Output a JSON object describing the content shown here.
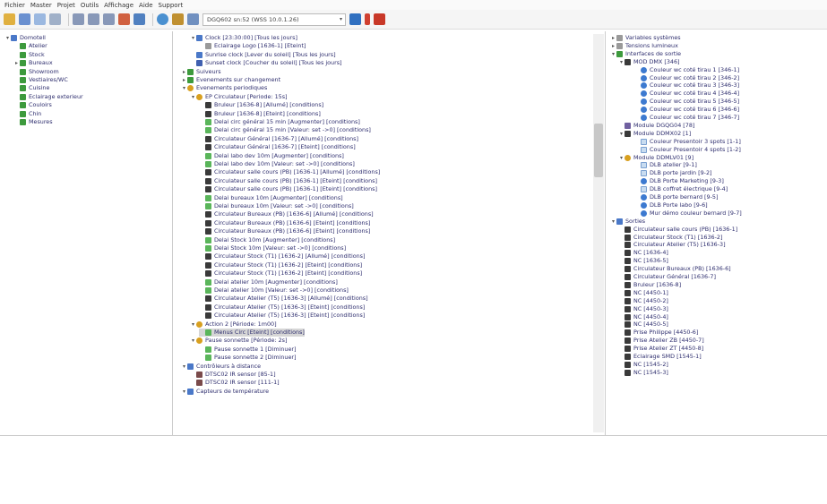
{
  "menu": [
    "Fichier",
    "Master",
    "Projet",
    "Outils",
    "Affichage",
    "Aide",
    "Support"
  ],
  "toolbar": {
    "server": "DGQ602 sn:52 (WSS 10.0.1.26)",
    "icon_names": [
      "folder-icon",
      "new-icon",
      "save-icon",
      "undo-icon",
      "redo-icon",
      "prev-icon",
      "next-icon",
      "scene-icon",
      "tools-icon",
      "monitor-icon",
      "globe-icon",
      "user-icon",
      "device-icon",
      "refresh-icon",
      "flag-icon",
      "stop-icon"
    ]
  },
  "left": [
    {
      "t": "▾",
      "i": "b",
      "l": "Domotell",
      "d": 0
    },
    {
      "t": "",
      "i": "g",
      "l": "Atelier",
      "d": 1
    },
    {
      "t": "",
      "i": "g",
      "l": "Stock",
      "d": 1
    },
    {
      "t": "▸",
      "i": "g",
      "l": "Bureaux",
      "d": 1
    },
    {
      "t": "",
      "i": "g",
      "l": "Showroom",
      "d": 1
    },
    {
      "t": "",
      "i": "g",
      "l": "Vestiaires/WC",
      "d": 1
    },
    {
      "t": "",
      "i": "g",
      "l": "Cuisine",
      "d": 1
    },
    {
      "t": "",
      "i": "g",
      "l": "Eclairage exterieur",
      "d": 1
    },
    {
      "t": "",
      "i": "g",
      "l": "Couloirs",
      "d": 1
    },
    {
      "t": "",
      "i": "g",
      "l": "Chin",
      "d": 1
    },
    {
      "t": "",
      "i": "g",
      "l": "Mesures",
      "d": 1
    }
  ],
  "mid": [
    {
      "t": "▾",
      "i": "b",
      "l": "Clock [23:30:00] [Tous les jours]",
      "d": 1
    },
    {
      "t": "",
      "i": "gr",
      "l": "Eclairage Logo [1636-1] [Eteint]",
      "d": 2
    },
    {
      "t": "",
      "i": "b",
      "l": "Sunrise clock [Lever du soleil] [Tous les jours]",
      "d": 1
    },
    {
      "t": "",
      "i": "db",
      "l": "Sunset clock [Coucher du soleil] [Tous les jours]",
      "d": 1
    },
    {
      "t": "▸",
      "i": "g",
      "l": "Suiveurs",
      "d": 0
    },
    {
      "t": "▸",
      "i": "g",
      "l": "Evenements sur changement",
      "d": 0
    },
    {
      "t": "▾",
      "i": "o",
      "l": "Evenements periodiques",
      "d": 0
    },
    {
      "t": "▾",
      "i": "o",
      "l": "EP Circulateur [Periode: 15s]",
      "d": 1
    },
    {
      "t": "",
      "i": "dk",
      "l": "Bruleur [1636-8] [Allumé] [conditions]",
      "d": 2
    },
    {
      "t": "",
      "i": "dk",
      "l": "Bruleur [1636-8] [Eteint] [conditions]",
      "d": 2
    },
    {
      "t": "",
      "i": "lg",
      "l": "Delai circ général 15 min [Augmenter] [conditions]",
      "d": 2
    },
    {
      "t": "",
      "i": "lg",
      "l": "Delai circ général 15 min [Valeur: set ->0] [conditions]",
      "d": 2
    },
    {
      "t": "",
      "i": "dk",
      "l": "Circulateur Général [1636-7] [Allumé] [conditions]",
      "d": 2
    },
    {
      "t": "",
      "i": "dk",
      "l": "Circulateur Général [1636-7] [Eteint] [conditions]",
      "d": 2
    },
    {
      "t": "",
      "i": "lg",
      "l": "Delai labo dev 10m [Augmenter] [conditions]",
      "d": 2
    },
    {
      "t": "",
      "i": "lg",
      "l": "Delai labo dev 10m [Valeur: set ->0] [conditions]",
      "d": 2
    },
    {
      "t": "",
      "i": "dk",
      "l": "Circulateur salle cours (PB) [1636-1] [Allumé] [conditions]",
      "d": 2
    },
    {
      "t": "",
      "i": "dk",
      "l": "Circulateur salle cours (PB) [1636-1] [Eteint] [conditions]",
      "d": 2
    },
    {
      "t": "",
      "i": "dk",
      "l": "Circulateur salle cours (PB) [1636-1] [Eteint] [conditions]",
      "d": 2
    },
    {
      "t": "",
      "i": "lg",
      "l": "Delai bureaux 10m [Augmenter] [conditions]",
      "d": 2
    },
    {
      "t": "",
      "i": "lg",
      "l": "Delai bureaux 10m [Valeur: set ->0] [conditions]",
      "d": 2
    },
    {
      "t": "",
      "i": "dk",
      "l": "Circulateur Bureaux (PB) [1636-6] [Allumé] [conditions]",
      "d": 2
    },
    {
      "t": "",
      "i": "dk",
      "l": "Circulateur Bureaux (PB) [1636-6] [Eteint] [conditions]",
      "d": 2
    },
    {
      "t": "",
      "i": "dk",
      "l": "Circulateur Bureaux (PB) [1636-6] [Eteint] [conditions]",
      "d": 2
    },
    {
      "t": "",
      "i": "lg",
      "l": "Delai Stock 10m [Augmenter] [conditions]",
      "d": 2
    },
    {
      "t": "",
      "i": "lg",
      "l": "Delai Stock 10m [Valeur: set ->0] [conditions]",
      "d": 2
    },
    {
      "t": "",
      "i": "dk",
      "l": "Circulateur Stock (T1) [1636-2] [Allumé] [conditions]",
      "d": 2
    },
    {
      "t": "",
      "i": "dk",
      "l": "Circulateur Stock (T1) [1636-2] [Eteint] [conditions]",
      "d": 2
    },
    {
      "t": "",
      "i": "dk",
      "l": "Circulateur Stock (T1) [1636-2] [Eteint] [conditions]",
      "d": 2
    },
    {
      "t": "",
      "i": "lg",
      "l": "Delai atelier 10m [Augmenter] [conditions]",
      "d": 2
    },
    {
      "t": "",
      "i": "lg",
      "l": "Delai atelier 10m [Valeur: set ->0] [conditions]",
      "d": 2
    },
    {
      "t": "",
      "i": "dk",
      "l": "Circulateur Atelier (T5) [1636-3] [Allumé] [conditions]",
      "d": 2
    },
    {
      "t": "",
      "i": "dk",
      "l": "Circulateur Atelier (T5) [1636-3] [Eteint] [conditions]",
      "d": 2
    },
    {
      "t": "",
      "i": "dk",
      "l": "Circulateur Atelier (T5) [1636-3] [Eteint] [conditions]",
      "d": 2
    },
    {
      "t": "▾",
      "i": "o",
      "l": "Action 2 [Période: 1m00]",
      "d": 1
    },
    {
      "t": "",
      "i": "lg",
      "l": "Menus Circ [Eteint] [conditions]",
      "d": 2,
      "sel": true
    },
    {
      "t": "▾",
      "i": "o",
      "l": "Pause sonnette [Période: 2s]",
      "d": 1
    },
    {
      "t": "",
      "i": "lg",
      "l": "Pause sonnette 1 [Diminuer]",
      "d": 2
    },
    {
      "t": "",
      "i": "lg",
      "l": "Pause sonnette 2 [Diminuer]",
      "d": 2
    },
    {
      "t": "▾",
      "i": "b",
      "l": "Contrôleurs à distance",
      "d": 0
    },
    {
      "t": "",
      "i": "br",
      "l": "DTSC02 IR sensor [85-1]",
      "d": 1
    },
    {
      "t": "",
      "i": "br",
      "l": "DTSC02 IR sensor [111-1]",
      "d": 1
    },
    {
      "t": "▾",
      "i": "b",
      "l": "Capteurs de température",
      "d": 0
    }
  ],
  "right": [
    {
      "t": "▸",
      "i": "gr",
      "l": "Variables systèmes",
      "d": 0
    },
    {
      "t": "▸",
      "i": "gr",
      "l": "Tensions lumineux",
      "d": 0
    },
    {
      "t": "▾",
      "i": "g",
      "l": "Interfaces de sortie",
      "d": 0
    },
    {
      "t": "▾",
      "i": "dk",
      "l": "MOD DMX [346]",
      "d": 1
    },
    {
      "t": "",
      "i": "cir",
      "l": "Couleur wc coté tirau 1 [346-1]",
      "d": 3
    },
    {
      "t": "",
      "i": "cir",
      "l": "Couleur wc coté tirau 2 [346-2]",
      "d": 3
    },
    {
      "t": "",
      "i": "cir",
      "l": "Couleur wc coté tirau 3 [346-3]",
      "d": 3
    },
    {
      "t": "",
      "i": "cir",
      "l": "Couleur wc coté tirau 4 [346-4]",
      "d": 3
    },
    {
      "t": "",
      "i": "cir",
      "l": "Couleur wc coté tirau 5 [346-5]",
      "d": 3
    },
    {
      "t": "",
      "i": "cir",
      "l": "Couleur wc coté tirau 6 [346-6]",
      "d": 3
    },
    {
      "t": "",
      "i": "cir",
      "l": "Couleur wc coté tirau 7 [346-7]",
      "d": 3
    },
    {
      "t": "",
      "i": "pu",
      "l": "Module DGQG04 [78]",
      "d": 1
    },
    {
      "t": "▾",
      "i": "dk",
      "l": "Module DDMX02 [1]",
      "d": 1
    },
    {
      "t": "",
      "i": "lb",
      "l": "Couleur Presentoir 3 spots [1-1]",
      "d": 3
    },
    {
      "t": "",
      "i": "lb",
      "l": "Couleur Presentoir 4 spots [1-2]",
      "d": 3
    },
    {
      "t": "▾",
      "i": "o",
      "l": "Module DDMLV01 [9]",
      "d": 1
    },
    {
      "t": "",
      "i": "lb",
      "l": "DLB atelier [9-1]",
      "d": 3
    },
    {
      "t": "",
      "i": "lb",
      "l": "DLB porte jardin [9-2]",
      "d": 3
    },
    {
      "t": "",
      "i": "cir",
      "l": "DLB Porte Marketing [9-3]",
      "d": 3
    },
    {
      "t": "",
      "i": "lb",
      "l": "DLB coffret électrique [9-4]",
      "d": 3
    },
    {
      "t": "",
      "i": "cir",
      "l": "DLB porte bernard [9-5]",
      "d": 3
    },
    {
      "t": "",
      "i": "cir",
      "l": "DLB Porte labo [9-6]",
      "d": 3
    },
    {
      "t": "",
      "i": "cir",
      "l": "Mur démo couleur bernard [9-7]",
      "d": 3
    },
    {
      "t": "▾",
      "i": "b",
      "l": "Sorties",
      "d": 0
    },
    {
      "t": "",
      "i": "dk",
      "l": "Circulateur salle cours (PB) [1636-1]",
      "d": 1
    },
    {
      "t": "",
      "i": "dk",
      "l": "Circulateur Stock (T1) [1636-2]",
      "d": 1
    },
    {
      "t": "",
      "i": "dk",
      "l": "Circulateur Atelier (T5) [1636-3]",
      "d": 1
    },
    {
      "t": "",
      "i": "dk",
      "l": "NC [1636-4]",
      "d": 1
    },
    {
      "t": "",
      "i": "dk",
      "l": "NC [1636-5]",
      "d": 1
    },
    {
      "t": "",
      "i": "dk",
      "l": "Circulateur Bureaux (PB) [1636-6]",
      "d": 1
    },
    {
      "t": "",
      "i": "dk",
      "l": "Circulateur Général [1636-7]",
      "d": 1
    },
    {
      "t": "",
      "i": "dk",
      "l": "Bruleur [1636-8]",
      "d": 1
    },
    {
      "t": "",
      "i": "dk",
      "l": "NC [4450-1]",
      "d": 1
    },
    {
      "t": "",
      "i": "dk",
      "l": "NC [4450-2]",
      "d": 1
    },
    {
      "t": "",
      "i": "dk",
      "l": "NC [4450-3]",
      "d": 1
    },
    {
      "t": "",
      "i": "dk",
      "l": "NC [4450-4]",
      "d": 1
    },
    {
      "t": "",
      "i": "dk",
      "l": "NC [4450-5]",
      "d": 1
    },
    {
      "t": "",
      "i": "dk",
      "l": "Prise Philippe [4450-6]",
      "d": 1
    },
    {
      "t": "",
      "i": "dk",
      "l": "Prise Atelier ZB [4450-7]",
      "d": 1
    },
    {
      "t": "",
      "i": "dk",
      "l": "Prise Atelier ZT [4450-8]",
      "d": 1
    },
    {
      "t": "",
      "i": "dk",
      "l": "Eclairage SMD [1545-1]",
      "d": 1
    },
    {
      "t": "",
      "i": "dk",
      "l": "NC [1545-2]",
      "d": 1
    },
    {
      "t": "",
      "i": "dk",
      "l": "NC [1545-3]",
      "d": 1
    }
  ]
}
